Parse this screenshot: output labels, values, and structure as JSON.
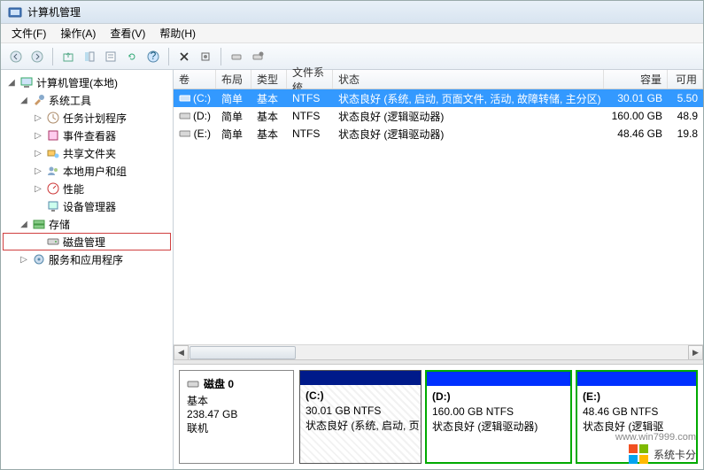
{
  "title": "计算机管理",
  "menus": {
    "file": "文件(F)",
    "action": "操作(A)",
    "view": "查看(V)",
    "help": "帮助(H)"
  },
  "tree": {
    "root": "计算机管理(本地)",
    "systools": "系统工具",
    "task": "任务计划程序",
    "event": "事件查看器",
    "share": "共享文件夹",
    "users": "本地用户和组",
    "perf": "性能",
    "devmgr": "设备管理器",
    "storage": "存储",
    "diskmgmt": "磁盘管理",
    "services": "服务和应用程序"
  },
  "cols": {
    "vol": "卷",
    "layout": "布局",
    "type": "类型",
    "fs": "文件系统",
    "status": "状态",
    "cap": "容量",
    "free": "可用"
  },
  "vols": [
    {
      "name": "(C:)",
      "layout": "简单",
      "type": "基本",
      "fs": "NTFS",
      "status": "状态良好 (系统, 启动, 页面文件, 活动, 故障转储, 主分区)",
      "cap": "30.01 GB",
      "free": "5.50"
    },
    {
      "name": "(D:)",
      "layout": "简单",
      "type": "基本",
      "fs": "NTFS",
      "status": "状态良好 (逻辑驱动器)",
      "cap": "160.00 GB",
      "free": "48.9"
    },
    {
      "name": "(E:)",
      "layout": "简单",
      "type": "基本",
      "fs": "NTFS",
      "status": "状态良好 (逻辑驱动器)",
      "cap": "48.46 GB",
      "free": "19.8"
    }
  ],
  "disk": {
    "label": "磁盘 0",
    "type": "基本",
    "size": "238.47 GB",
    "state": "联机",
    "parts": {
      "c": {
        "name": "(C:)",
        "info": "30.01 GB NTFS",
        "status": "状态良好 (系统, 启动, 页"
      },
      "d": {
        "name": "(D:)",
        "info": "160.00 GB NTFS",
        "status": "状态良好 (逻辑驱动器)"
      },
      "e": {
        "name": "(E:)",
        "info": "48.46 GB NTFS",
        "status": "状态良好 (逻辑驱"
      }
    }
  },
  "watermark": {
    "text": "系统卡分",
    "url": "www.win7999.com"
  }
}
